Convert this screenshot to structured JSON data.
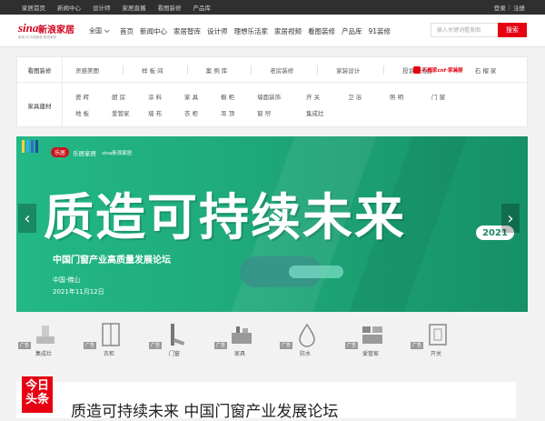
{
  "topbar": {
    "links": [
      "家居首页",
      "新闻中心",
      "设计师",
      "家居直播",
      "看图装修",
      "产品库"
    ],
    "login": "登录",
    "register": "注册"
  },
  "header": {
    "logo_brand": "sina",
    "logo_cn": "新浪家居",
    "logo_slogan": "影响1亿中国家庭·新浪家居",
    "city": "全国",
    "nav": [
      "首页",
      "新闻中心",
      "家居智库",
      "设计师",
      "理想乐活家",
      "家居视频",
      "看图装修",
      "产品库",
      "91装修"
    ],
    "search_placeholder": "输入关键词看美图",
    "search_button": "搜索"
  },
  "categories": {
    "decor_label": "看图装修",
    "decor_items": [
      "灵感美图",
      "样 板 间",
      "案 例 库",
      "老房装修",
      "家装设计",
      "投诉曝光台",
      "石 榴 家"
    ],
    "promo_text": "石榴家cnf·家装厨",
    "materials_label": "家具建材",
    "materials_row1": [
      "瓷 砖",
      "厨 房",
      "涂 料",
      "家 具",
      "橱 柜",
      "墙面装饰",
      "开 关",
      "卫 浴",
      "照 明",
      "门 窗"
    ],
    "materials_row2": [
      "地 板",
      "爱管家",
      "墙 布",
      "衣 柜",
      "吊 顶",
      "窗 帘",
      "集成灶"
    ]
  },
  "banner": {
    "brand_tag": "乐居",
    "brand_name": "乐居家居",
    "partner": "sina新浪家居",
    "headline": "质造可持续未来",
    "year": "2021",
    "subtitle": "中国门窗产业高质量发展论坛",
    "location": "中国·佛山",
    "date": "2021年11月12日",
    "colors": {
      "primary": "#23b887",
      "dark": "#169067"
    }
  },
  "products": [
    {
      "tag": "广告",
      "label": "集成灶",
      "icon": "range-hood-icon"
    },
    {
      "tag": "广告",
      "label": "衣柜",
      "icon": "wardrobe-icon"
    },
    {
      "tag": "广告",
      "label": "门窗",
      "icon": "window-icon"
    },
    {
      "tag": "广告",
      "label": "家具",
      "icon": "cabinet-icon"
    },
    {
      "tag": "广告",
      "label": "防水",
      "icon": "water-drop-icon"
    },
    {
      "tag": "广告",
      "label": "爱管家",
      "icon": "home-appliance-icon"
    },
    {
      "tag": "广告",
      "label": "开关",
      "icon": "switch-icon"
    }
  ],
  "news": {
    "badge_line1": "今日",
    "badge_line2": "头条",
    "title": "质造可持续未来 中国门窗产业发展论坛"
  },
  "accent": "#e60012"
}
